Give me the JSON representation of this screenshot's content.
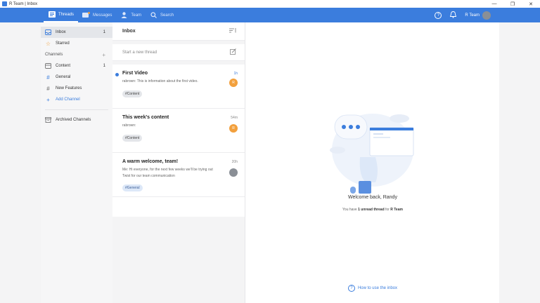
{
  "window": {
    "title": "R Team | Inbox",
    "controls": [
      "—",
      "❐",
      "✕"
    ]
  },
  "nav": {
    "items": [
      {
        "label": "Threads",
        "icon": "threads-icon",
        "active": true
      },
      {
        "label": "Messages",
        "icon": "messages-icon",
        "active": false
      },
      {
        "label": "Team",
        "icon": "team-icon",
        "active": false
      },
      {
        "label": "Search",
        "icon": "search-icon",
        "active": false
      }
    ],
    "help_glyph": "?",
    "org_name": "R Team"
  },
  "sidebar": {
    "inbox": {
      "label": "Inbox",
      "count": "1"
    },
    "starred": {
      "label": "Starred"
    },
    "channels_header": "Channels",
    "channels": [
      {
        "label": "Content",
        "count": "1"
      },
      {
        "label": "General",
        "count": ""
      },
      {
        "label": "New Features",
        "count": ""
      }
    ],
    "add_channel": "Add Channel",
    "archived": "Archived Channels"
  },
  "inbox": {
    "title": "Inbox",
    "new_thread_placeholder": "Start a new thread",
    "threads": [
      {
        "title": "First Video",
        "time": "1h",
        "snippet": "rabrown: This is information about the first video.",
        "tag": "#Content",
        "avatar": "R",
        "unread": true
      },
      {
        "title": "This week's content",
        "time": "54m",
        "snippet": "rabrown:",
        "tag": "#Content",
        "avatar": "R",
        "unread": false
      },
      {
        "title": "A warm welcome, team!",
        "time": "20h",
        "snippet": "Me: Hi everyone, for the next few weeks we'll be trying out Twist for our team communication",
        "tag": "#General",
        "avatar": "",
        "unread": false
      }
    ]
  },
  "main": {
    "welcome": "Welcome back, Randy",
    "sub_prefix": "You have",
    "sub_bold": "1 unread thread",
    "sub_mid": "for",
    "sub_team": "R Team",
    "howto": "How to use the inbox"
  },
  "colors": {
    "accent": "#3b7ddd",
    "avatar_orange": "#f2a03d"
  }
}
